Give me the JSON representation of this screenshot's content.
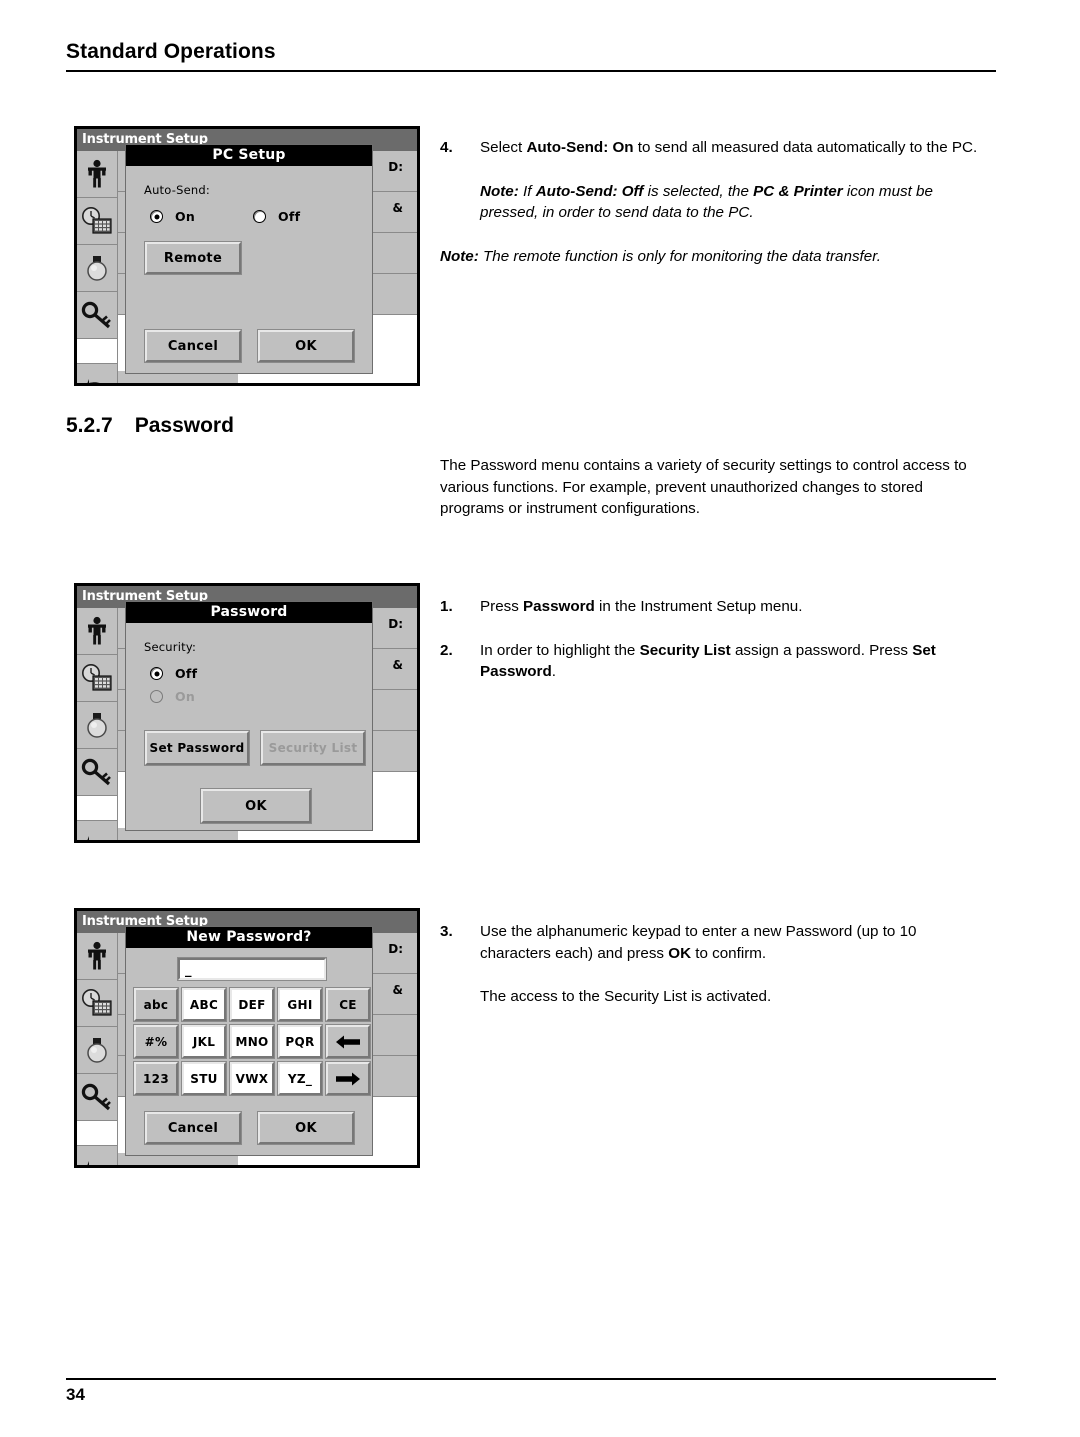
{
  "page": {
    "header_title": "Standard Operations",
    "page_number": "34"
  },
  "section": {
    "number": "5.2.7",
    "title": "Password",
    "intro": "The Password menu contains a variety of security settings to control access to various functions. For example, prevent unauthorized changes to stored programs or instrument configurations."
  },
  "steps": {
    "step4_num": "4.",
    "step4_a": "Select ",
    "step4_bold": "Auto-Send: On",
    "step4_b": " to send all measured data automatically to the PC.",
    "note1_lead": "Note:",
    "note1_a": " If ",
    "note1_bold1": "Auto-Send: Off",
    "note1_b": " is selected, the ",
    "note1_bold2": "PC & Printer",
    "note1_c": " icon must be pressed, in order to send data to the PC.",
    "note2_lead": "Note:",
    "note2_text": " The remote function is only for monitoring the data transfer.",
    "step1_num": "1.",
    "step1_a": "Press ",
    "step1_bold": "Password",
    "step1_b": " in the Instrument Setup menu.",
    "step2_num": "2.",
    "step2_a": "In order to highlight the ",
    "step2_bold1": "Security List",
    "step2_b": " assign a password. Press ",
    "step2_bold2": "Set Password",
    "step2_c": ".",
    "step3_num": "3.",
    "step3_a": "Use the alphanumeric keypad to enter a new Password (up to 10 characters each) and press ",
    "step3_bold": "OK",
    "step3_b": " to confirm.",
    "step3_follow": "The access to the Security List is activated."
  },
  "screens": {
    "instrument_setup_title": "Instrument Setup",
    "menu_fragments": [
      "D:",
      "&",
      "",
      ""
    ],
    "rail_icons": [
      "operator-icon",
      "clock-keypad-icon",
      "lamp-icon",
      "key-icon",
      "blank",
      "back-arrow-icon"
    ],
    "pc_setup": {
      "dialog_title": "PC Setup",
      "field_label": "Auto-Send:",
      "radio_on": "On",
      "radio_off": "Off",
      "selected": "On",
      "remote_button": "Remote",
      "cancel_button": "Cancel",
      "ok_button": "OK"
    },
    "password": {
      "dialog_title": "Password",
      "field_label": "Security:",
      "radio_off": "Off",
      "radio_on": "On",
      "selected": "Off",
      "set_password_button": "Set Password",
      "security_list_button": "Security List",
      "ok_button": "OK"
    },
    "new_password": {
      "dialog_title": "New Password?",
      "input_value": "_",
      "keys": [
        "abc",
        "ABC",
        "DEF",
        "GHI",
        "CE",
        "#%",
        "JKL",
        "MNO",
        "PQR",
        "left-arrow-icon",
        "123",
        "STU",
        "VWX",
        "YZ_",
        "right-arrow-icon"
      ],
      "cancel_button": "Cancel",
      "ok_button": "OK"
    }
  },
  "colors": {
    "screen_gray": "#c0c0c0",
    "titlebar_gray": "#6b6b6b",
    "dialog_title_bg": "#000000",
    "disabled_text": "#9a9a9a"
  }
}
